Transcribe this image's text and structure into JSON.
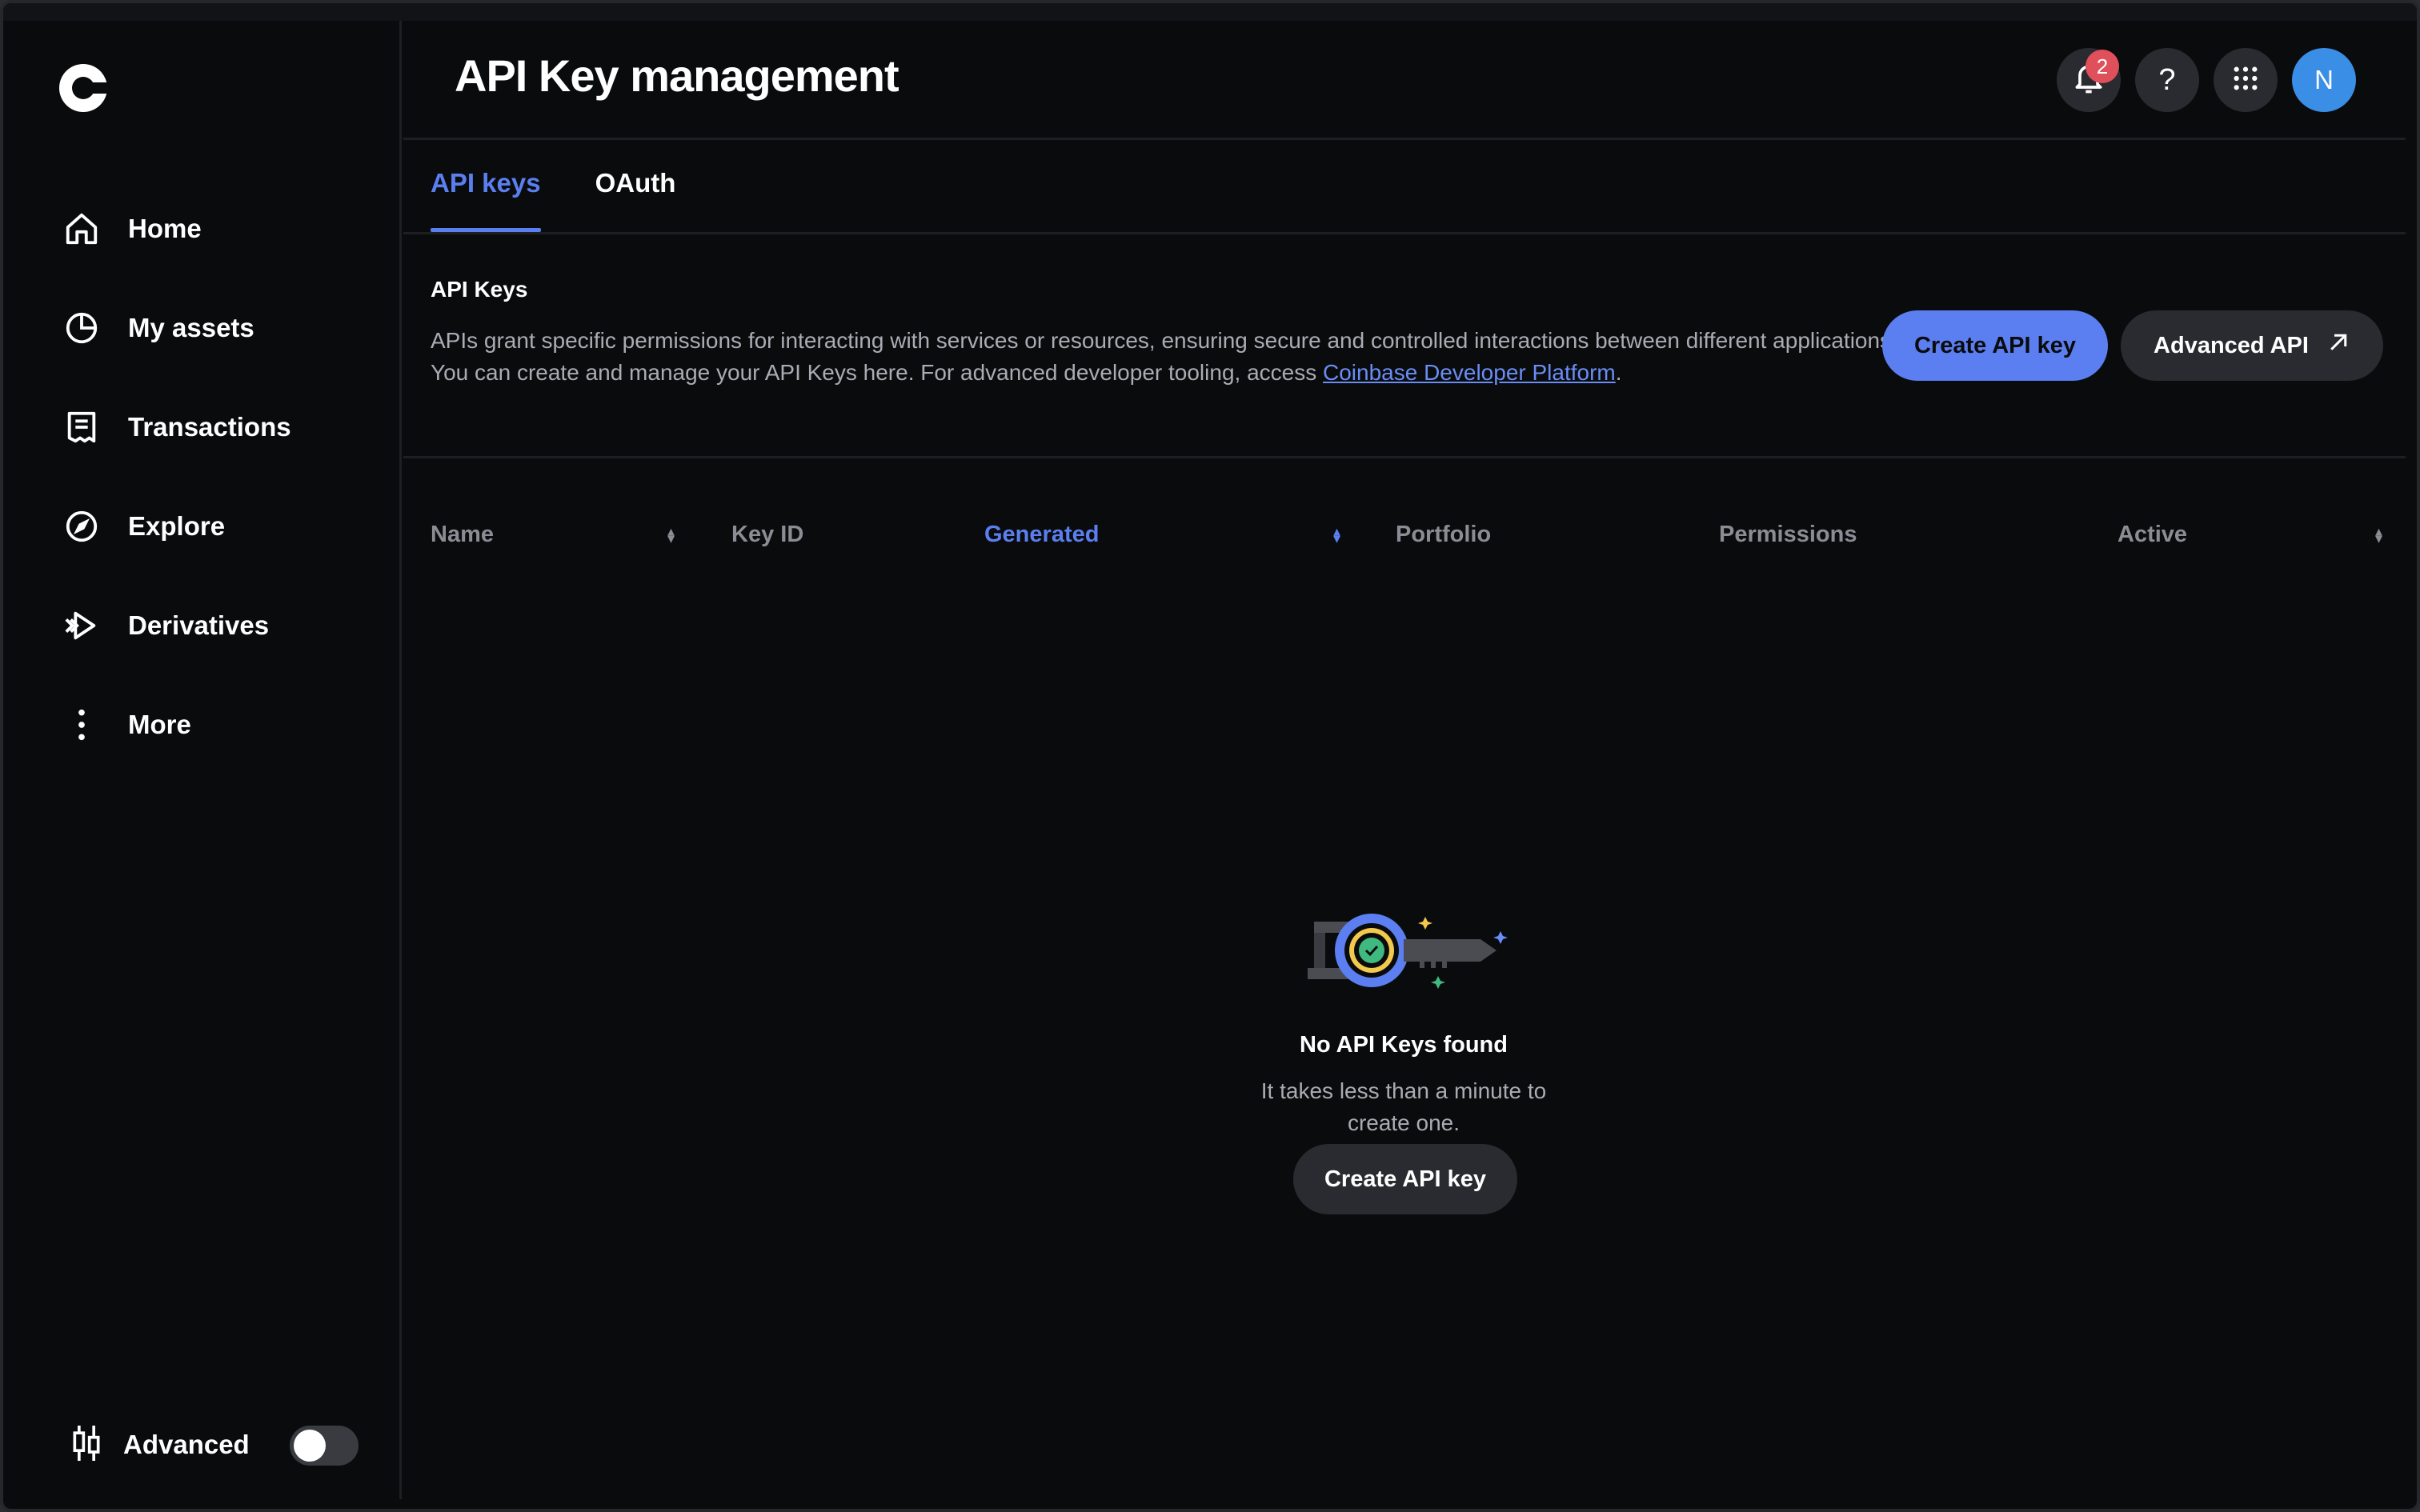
{
  "sidebar": {
    "items": [
      {
        "label": "Home",
        "icon": "home-icon"
      },
      {
        "label": "My assets",
        "icon": "pie-chart-icon"
      },
      {
        "label": "Transactions",
        "icon": "receipt-icon"
      },
      {
        "label": "Explore",
        "icon": "compass-icon"
      },
      {
        "label": "Derivatives",
        "icon": "derivatives-icon"
      },
      {
        "label": "More",
        "icon": "more-vertical-icon"
      }
    ],
    "advanced_label": "Advanced",
    "advanced_enabled": false
  },
  "header": {
    "title": "API Key management",
    "notification_count": "2",
    "help_glyph": "?",
    "avatar_initial": "N"
  },
  "tabs": [
    {
      "label": "API keys",
      "active": true
    },
    {
      "label": "OAuth",
      "active": false
    }
  ],
  "section": {
    "title": "API Keys",
    "description_prefix": "APIs grant specific permissions for interacting with services or resources, ensuring secure and controlled interactions between different applications. You can create and manage your API Keys here. For advanced developer tooling, access ",
    "link_text": "Coinbase Developer Platform",
    "description_suffix": ".",
    "create_label": "Create API key",
    "advanced_api_label": "Advanced API"
  },
  "table": {
    "columns": [
      "Name",
      "Key ID",
      "Generated",
      "Portfolio",
      "Permissions",
      "Active"
    ],
    "active_column": "Generated"
  },
  "empty_state": {
    "title": "No API Keys found",
    "subtitle": "It takes less than a minute to create one.",
    "button_label": "Create API key"
  },
  "colors": {
    "accent": "#5b7ff0",
    "background": "#0a0b0d",
    "badge": "#e0505a",
    "avatar": "#3a8ee6"
  }
}
